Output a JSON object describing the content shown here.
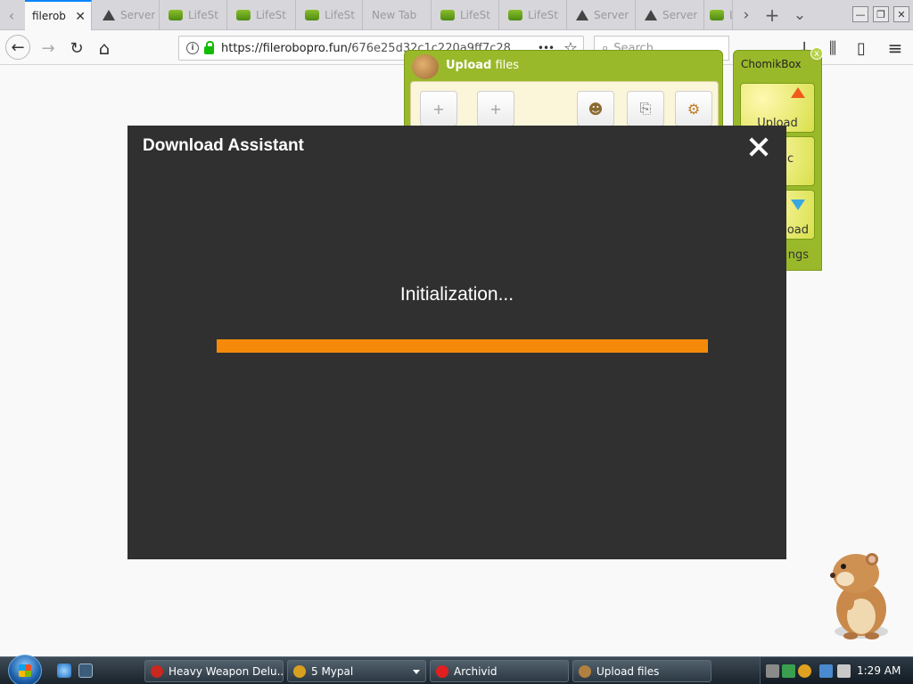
{
  "browser": {
    "tabs": [
      {
        "label": "filerob",
        "icon": "none",
        "active": true
      },
      {
        "label": "Server",
        "icon": "warning-icon"
      },
      {
        "label": "LifeSt",
        "icon": "site-icon"
      },
      {
        "label": "LifeSt",
        "icon": "site-icon"
      },
      {
        "label": "LifeSt",
        "icon": "site-icon"
      },
      {
        "label": "New Tab",
        "icon": "none"
      },
      {
        "label": "LifeSt",
        "icon": "site-icon"
      },
      {
        "label": "LifeSt",
        "icon": "site-icon"
      },
      {
        "label": "Server",
        "icon": "warning-icon"
      },
      {
        "label": "Server",
        "icon": "warning-icon"
      },
      {
        "label": "L",
        "icon": "site-icon"
      }
    ],
    "tab_close_glyph": "✕",
    "url": {
      "host": "https://filerobopro.fun/",
      "path": "676e25d32c1c220a9ff7c28"
    },
    "search_placeholder": "Search",
    "glyphs": {
      "back": "←",
      "forward": "→",
      "reload": "↻",
      "home": "⌂",
      "page_actions": "•••",
      "bookmark": "☆",
      "new_tab": "+",
      "tab_list": "⌄",
      "scroll_left": "‹",
      "scroll_right": "›",
      "download": "↓",
      "library": "⫼",
      "sidebar": "▯",
      "menu": "≡",
      "minimize": "—",
      "restore": "❐",
      "close": "✕",
      "info": "i",
      "search": "⌕"
    }
  },
  "upload_widget": {
    "title_bold": "Upload",
    "title_rest": " files",
    "tools": [
      "add-file-icon",
      "add-folder-icon",
      "mascot-icon",
      "clipboard-add-icon",
      "settings-icon"
    ],
    "tool_glyphs": [
      "+",
      "+",
      "☻",
      "⎘",
      "⚙"
    ]
  },
  "chomikbox": {
    "title": "ChomikBox",
    "close": "x",
    "buttons": [
      "Upload",
      "c",
      "oad"
    ],
    "footer": "ngs"
  },
  "modal": {
    "title": "Download Assistant",
    "status": "Initialization...",
    "progress": 1.0,
    "accent": "#f58a0a"
  },
  "taskbar": {
    "tasks": [
      {
        "label": "Heavy Weapon Delu...",
        "color": "#c8281e"
      },
      {
        "label": "5 Mypal",
        "color": "#d8a020"
      },
      {
        "label": "Archivid",
        "color": "#e02020"
      },
      {
        "label": "Upload files",
        "color": "#b08040"
      }
    ],
    "clock": "1:29 AM"
  }
}
